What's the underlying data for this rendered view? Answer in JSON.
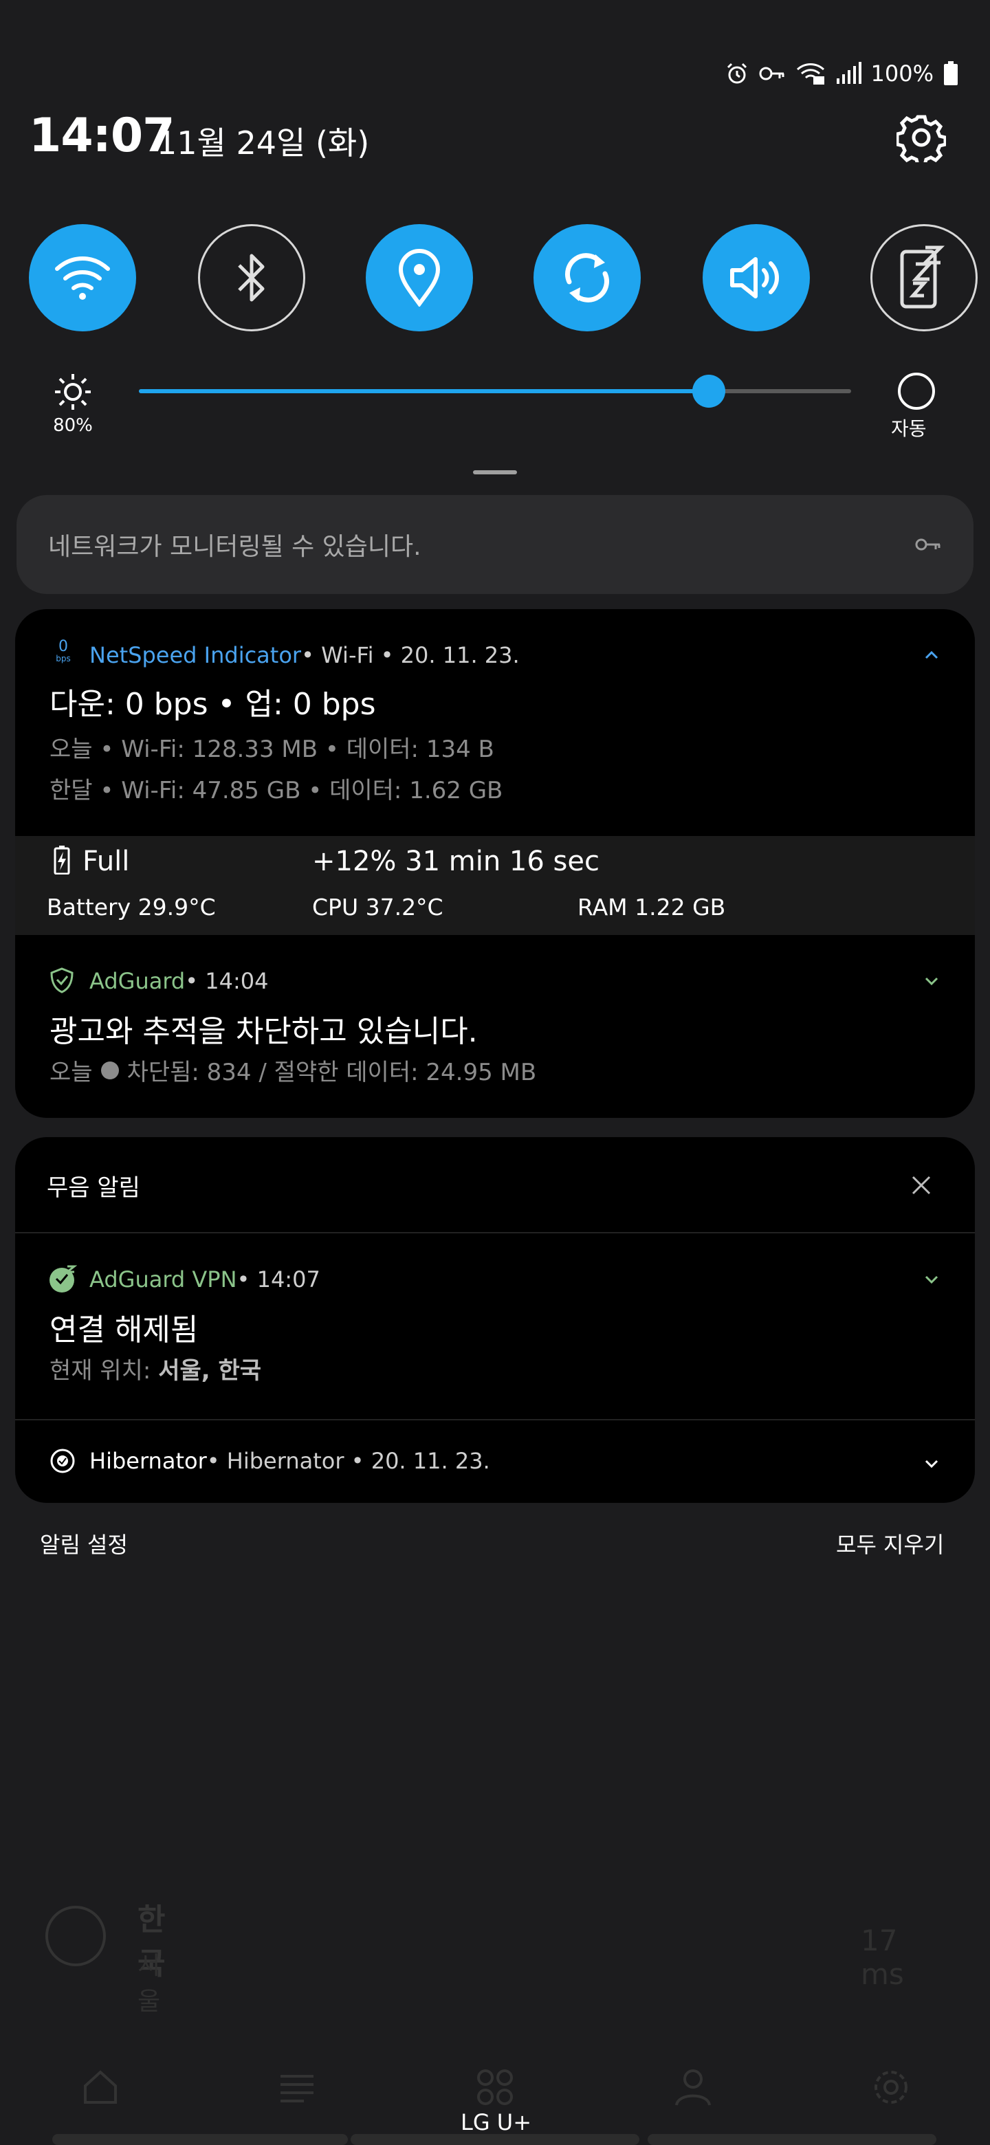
{
  "status_bar": {
    "battery_pct": "100%",
    "icons": [
      "alarm-icon",
      "vpn-key-icon",
      "wifi-icon",
      "signal-icon",
      "battery-icon"
    ]
  },
  "header": {
    "time": "14:07",
    "date": "11월 24일 (화)"
  },
  "quick_toggles": [
    {
      "name": "wifi",
      "state": "on"
    },
    {
      "name": "bluetooth",
      "state": "off"
    },
    {
      "name": "location",
      "state": "on"
    },
    {
      "name": "sync",
      "state": "on"
    },
    {
      "name": "sound",
      "state": "on"
    },
    {
      "name": "dnd",
      "state": "off"
    }
  ],
  "brightness": {
    "level_label": "80%",
    "slider_value_pct": 80,
    "auto_label": "자동"
  },
  "monitor_banner": {
    "text": "네트워크가 모니터링될 수 있습니다."
  },
  "netspeed": {
    "app_name": "NetSpeed Indicator",
    "meta": " • Wi-Fi • 20. 11. 23.",
    "icon_value": "0",
    "icon_unit": "bps",
    "title": "다운: 0 bps • 업: 0 bps",
    "line1": "오늘 • Wi-Fi: 128.33 MB •  데이터: 134 B",
    "line2": "한달 • Wi-Fi: 47.85 GB •  데이터: 1.62 GB"
  },
  "battery_widget": {
    "status": "Full",
    "change": "+12%  31 min 16 sec",
    "battery": "Battery  29.9°C",
    "cpu": "CPU  37.2°C",
    "ram": "RAM  1.22 GB"
  },
  "adguard": {
    "app_name": "AdGuard",
    "meta": " • 14:04",
    "title": "광고와 추적을 차단하고 있습니다.",
    "line_prefix": "오늘",
    "line_rest": "차단됨: 834 / 절약한 데이터: 24.95 MB"
  },
  "silent": {
    "header": "무음 알림",
    "vpn": {
      "app_name": "AdGuard VPN",
      "meta": " • 14:07",
      "title": "연결 해제됨",
      "line_label": "현재 위치: ",
      "line_value": "서울, 한국"
    },
    "hibernator": {
      "app_name": "Hibernator",
      "meta": " • Hibernator • 20. 11. 23."
    }
  },
  "footer": {
    "settings": "알림 설정",
    "clear_all": "모두 지우기"
  },
  "background_app": {
    "country": "한국",
    "city": "서울",
    "latency": "17 ms"
  },
  "carrier": "LG U+",
  "colors": {
    "accent": "#1fa5ef",
    "netspeed_blue": "#4aa3ef",
    "adguard_green": "#8bc48a"
  }
}
